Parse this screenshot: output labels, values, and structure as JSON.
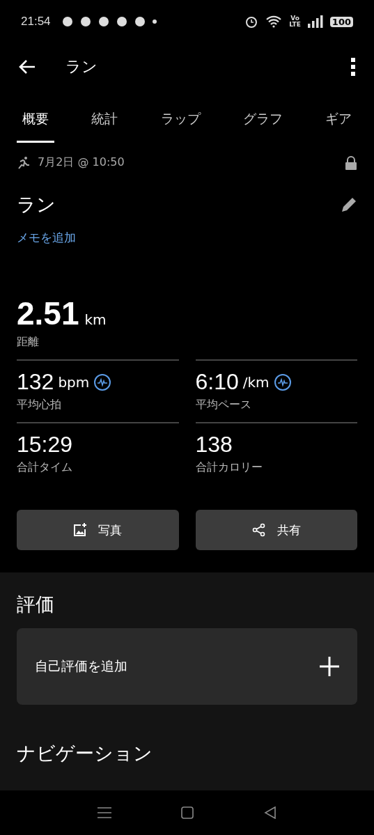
{
  "status_bar": {
    "time": "21:54",
    "battery": "100",
    "network": "Vo\nLTE"
  },
  "app_bar": {
    "title": "ラン"
  },
  "tabs": [
    {
      "label": "概要",
      "selected": true
    },
    {
      "label": "統計",
      "selected": false
    },
    {
      "label": "ラップ",
      "selected": false
    },
    {
      "label": "グラフ",
      "selected": false
    },
    {
      "label": "ギア",
      "selected": false
    }
  ],
  "activity": {
    "date": "7月2日 @ 10:50",
    "locked": true,
    "title": "ラン",
    "memo_link": "メモを追加"
  },
  "main_stat": {
    "value": "2.51",
    "unit": "km",
    "label": "距離"
  },
  "stats": [
    {
      "value": "132",
      "unit": "bpm",
      "label": "平均心拍",
      "chart_link": true
    },
    {
      "value": "6:10",
      "unit": "/km",
      "label": "平均ペース",
      "chart_link": true
    },
    {
      "value": "15:29",
      "label": "合計タイム",
      "chart_link": false
    },
    {
      "value": "138",
      "label": "合計カロリー",
      "chart_link": false
    }
  ],
  "buttons": [
    {
      "kind": "photo",
      "label": "写真"
    },
    {
      "kind": "share",
      "label": "共有"
    }
  ],
  "rating": {
    "heading": "評価",
    "add_label": "自己評価を追加"
  },
  "navigation": {
    "heading": "ナビゲーション"
  }
}
